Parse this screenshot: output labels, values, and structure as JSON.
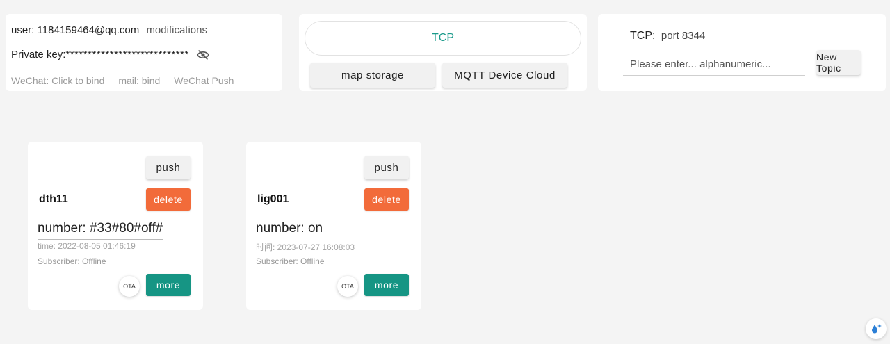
{
  "account": {
    "user_label": "user:",
    "user_value": "1184159464@qq.com",
    "modify_label": "modifications",
    "key_label": "Private key:",
    "key_value": "****************************",
    "eye_icon": "eye-off-icon",
    "links": [
      "WeChat: Click to bind",
      "mail: bind",
      "WeChat Push"
    ]
  },
  "protocol": {
    "active": "TCP",
    "map_storage": "map storage",
    "mqtt_cloud": "MQTT Device Cloud"
  },
  "topic": {
    "protocol_label": "TCP:",
    "port": "port 8344",
    "placeholder": "Please enter... alphanumeric...",
    "new_topic": "New Topic"
  },
  "devices": [
    {
      "name": "dth11",
      "push_label": "push",
      "delete_label": "delete",
      "number": "number: #33#80#off#",
      "time": "time: 2022-08-05 01:46:19",
      "subscriber": "Subscriber: Offline",
      "ota_label": "OTA",
      "more_label": "more"
    },
    {
      "name": "lig001",
      "push_label": "push",
      "delete_label": "delete",
      "number": "number: on",
      "time": "时间: 2023-07-27 16:08:03",
      "subscriber": "Subscriber: Offline",
      "ota_label": "OTA",
      "more_label": "more"
    }
  ],
  "colors": {
    "accent_teal": "#169584",
    "delete_orange": "#f26b3a",
    "tcp_text": "#1a9a8a",
    "background": "#f4f4f4"
  },
  "helper_icon": "water-drop-sparkle-icon"
}
